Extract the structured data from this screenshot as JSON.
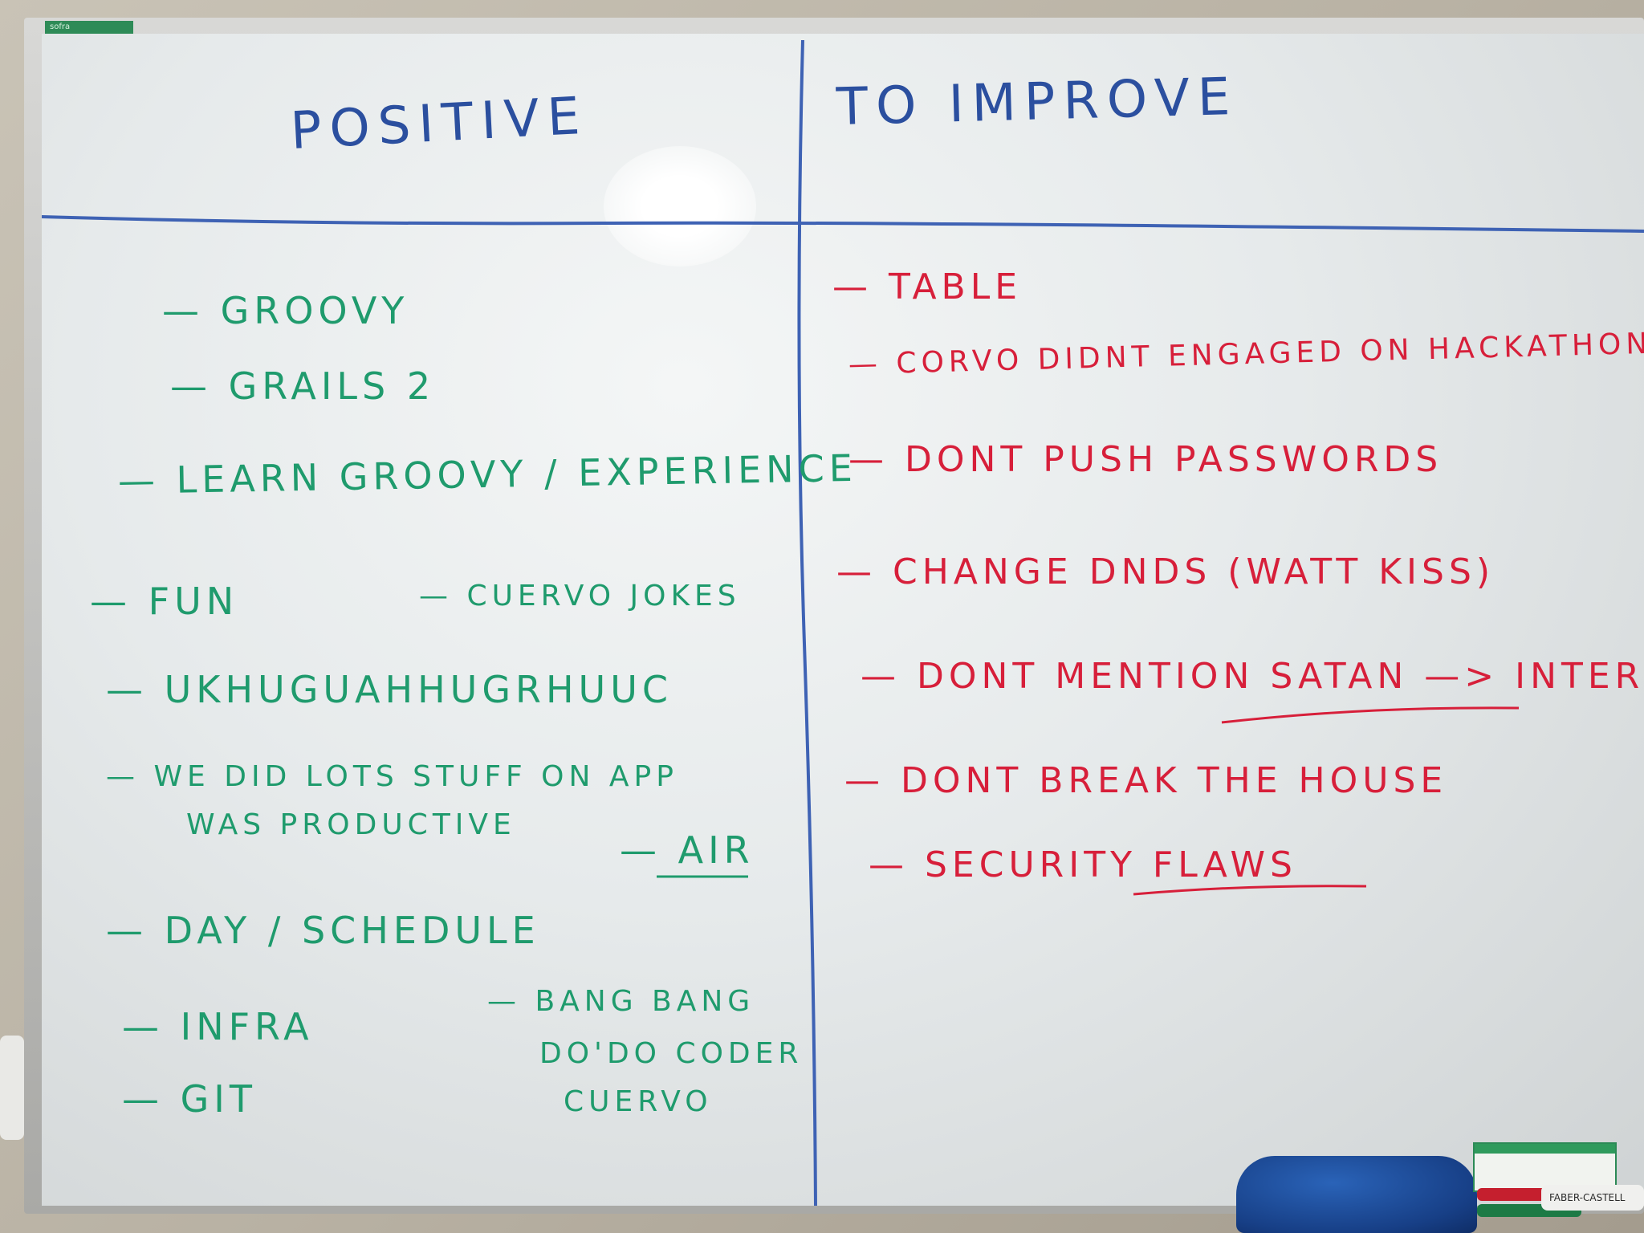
{
  "board": {
    "brand": "sofra",
    "headers": {
      "positive": "POSITIVE",
      "improve": "TO IMPROVE"
    },
    "positive_items": [
      "— GROOVY",
      "— GRAILS 2",
      "— LEARN GROOVY / EXPERIENCE",
      "— FUN",
      "— CUERVO JOKES",
      "— UKHUGUAHHUGRHUUC",
      "— WE DID LOTS STUFF ON APP",
      "WAS PRODUCTIVE",
      "— AIR",
      "— DAY / SCHEDULE",
      "— INFRA",
      "— GIT",
      "— BANG BANG",
      "DO'DO CODER",
      "CUERVO"
    ],
    "improve_items": [
      "— TABLE",
      "— CORVO DIDNT ENGAGED ON HACKATHON",
      "— DONT PUSH PASSWORDS",
      "— CHANGE DNDS (WATT KISS)",
      "— DONT MENTION SATAN —> INTERS",
      "— DONT BREAK THE HOUSE",
      "— SECURITY FLAWS"
    ],
    "accessory_label": "FABER-CASTELL",
    "colors": {
      "header_ink": "#2b4f9f",
      "positive_ink": "#1f9b6d",
      "improve_ink": "#d71f3a",
      "eraser": "#1a4a9a"
    }
  }
}
